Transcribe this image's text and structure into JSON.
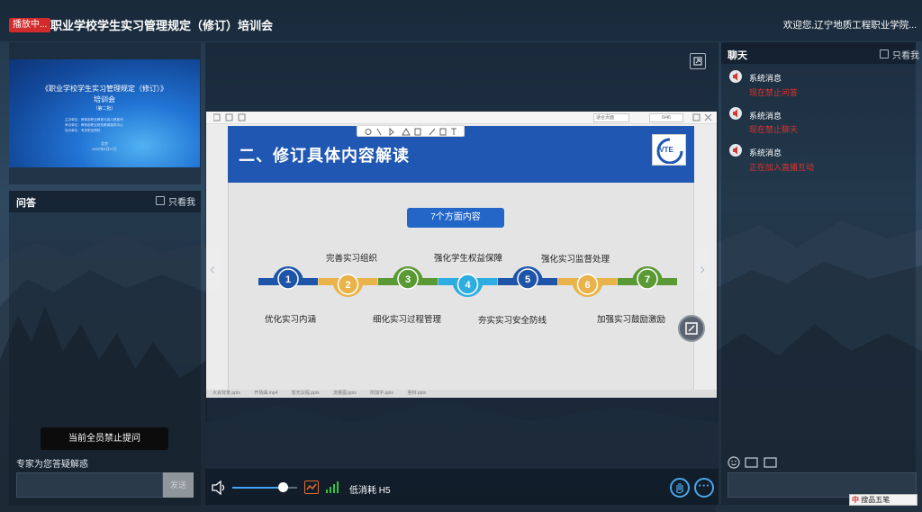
{
  "header": {
    "live_badge": "播放中...",
    "title": "职业学校学生实习管理规定（修订）培训会",
    "welcome": "欢迎您,辽宁地质工程职业学院..."
  },
  "thumbnail": {
    "title_line1": "《职业学校学生实习管理规定（修订）》",
    "title_line2": "培训会",
    "subtitle": "（第二批）",
    "org_lines": [
      "主办单位：教育部职业教育与成人教育司",
      "承办单位：教育部职业院校教育指导中心",
      "协办单位：有关职业院校"
    ],
    "footer_line1": "北京",
    "footer_line2": "2022年8月27日"
  },
  "qa": {
    "title": "问答",
    "only_me": "只看我",
    "banned_notice": "当前全员禁止提问",
    "expert_label": "专家为您答疑解惑",
    "send_label": "发送"
  },
  "slide": {
    "heading": "二、修订具体内容解读",
    "pill": "7个方面内容",
    "logo_text": "IVTE",
    "page_select": "适合页面",
    "page_number": "6/46",
    "labels_top": [
      "完善实习组织",
      "强化学生权益保障",
      "强化实习监督处理"
    ],
    "labels_bottom": [
      "优化实习内涵",
      "细化实习过程管理",
      "夯实实习安全防线",
      "加强实习鼓励激励"
    ],
    "steps": [
      "1",
      "2",
      "3",
      "4",
      "5",
      "6",
      "7"
    ],
    "step_colors": [
      "#1f55a8",
      "#e9b34b",
      "#5a9a34",
      "#2eaee0",
      "#1f55a8",
      "#e9b34b",
      "#5a9a34"
    ],
    "sheet_tabs": [
      "大会背景.pptx",
      "开场曲.mp4",
      "暂无议程.pptx",
      "流量图.pptx",
      "附加字.pptx",
      "答辩.pptx"
    ]
  },
  "controls": {
    "quality": "低消耗 H5"
  },
  "chat": {
    "title": "聊天",
    "only_me": "只看我",
    "messages": [
      {
        "sender": "系统消息",
        "text": "现在禁止问答"
      },
      {
        "sender": "系统消息",
        "text": "现在禁止聊天"
      },
      {
        "sender": "系统消息",
        "text": "正在加入直播互动"
      }
    ],
    "ime_label": "搜品五笔"
  }
}
